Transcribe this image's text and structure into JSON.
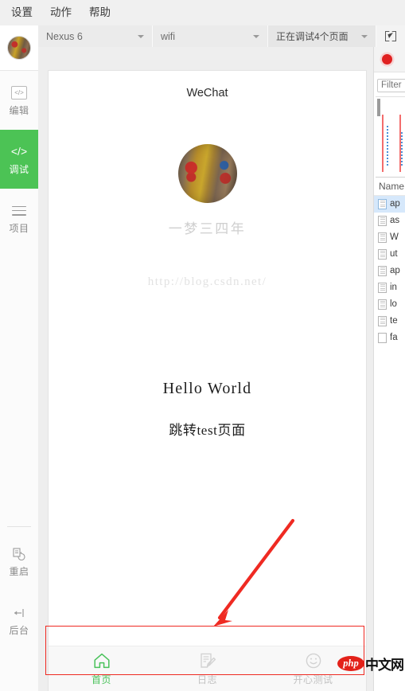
{
  "menubar": {
    "items": [
      {
        "label": "设置",
        "name": "menu-settings"
      },
      {
        "label": "动作",
        "name": "menu-actions"
      },
      {
        "label": "帮助",
        "name": "menu-help"
      }
    ]
  },
  "rail": {
    "avatar_alt": "user-avatar",
    "items": [
      {
        "label": "编辑",
        "icon": "code-box-icon",
        "active": false
      },
      {
        "label": "调试",
        "icon": "code-angle-icon",
        "active": true
      },
      {
        "label": "项目",
        "icon": "hamburger-icon",
        "active": false
      }
    ],
    "bottom_items": [
      {
        "label": "重启",
        "icon": "restart-icon"
      },
      {
        "label": "后台",
        "icon": "background-icon"
      }
    ]
  },
  "toolbar": {
    "device": "Nexus 6",
    "network": "wifi",
    "debug_status": "正在调试4个页面",
    "inspect_icon": "inspect-element-icon"
  },
  "phone": {
    "title": "WeChat",
    "profile_name": "一梦三四年",
    "blog_url": "http://blog.csdn.net/",
    "hello_text": "Hello World",
    "jump_text": "跳转test页面",
    "tabs": [
      {
        "label": "首页",
        "icon": "home-icon",
        "state": "active"
      },
      {
        "label": "日志",
        "icon": "edit-note-icon",
        "state": "idle"
      },
      {
        "label": "开心测试",
        "icon": "smiley-icon",
        "state": "idle"
      }
    ]
  },
  "devtools": {
    "record_icon": "record-button",
    "filter_placeholder": "Filter",
    "column_header": "Name",
    "requests": [
      {
        "name": "ap",
        "selected": true,
        "icon": "file-icon"
      },
      {
        "name": "as",
        "selected": false,
        "icon": "file-icon"
      },
      {
        "name": "W",
        "selected": false,
        "icon": "file-icon"
      },
      {
        "name": "ut",
        "selected": false,
        "icon": "file-icon"
      },
      {
        "name": "ap",
        "selected": false,
        "icon": "file-icon"
      },
      {
        "name": "in",
        "selected": false,
        "icon": "file-icon"
      },
      {
        "name": "lo",
        "selected": false,
        "icon": "file-icon"
      },
      {
        "name": "te",
        "selected": false,
        "icon": "file-icon"
      },
      {
        "name": "fa",
        "selected": false,
        "icon": "file-plain-icon"
      }
    ]
  },
  "annotation": {
    "arrow_color": "#ef2a22",
    "rect_color": "#ef2a22"
  },
  "watermark": {
    "logo": "php",
    "text": "中文网"
  },
  "colors": {
    "accent_green": "#4cc355",
    "tab_active": "#49c25a",
    "record_red": "#e02020"
  }
}
